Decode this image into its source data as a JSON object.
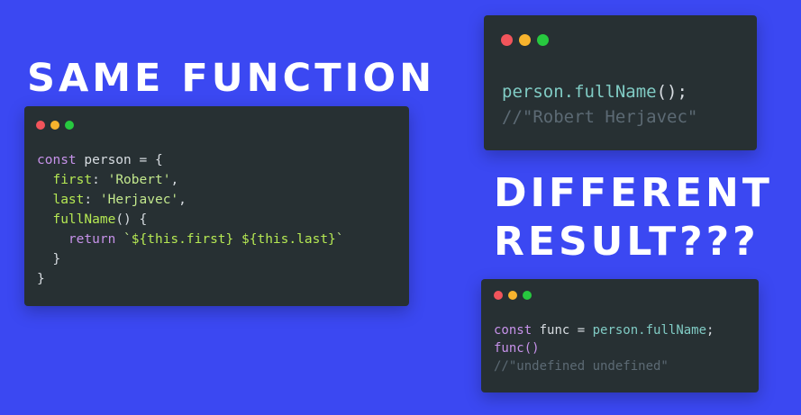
{
  "headline_top": "SAME FUNCTION",
  "headline_bottom_line1": "DIFFERENT",
  "headline_bottom_line2": "RESULT???",
  "colors": {
    "background": "#3b48f2",
    "window": "#273033",
    "dot_red": "#f2545b",
    "dot_yellow": "#f7b32d",
    "dot_green": "#27c93f"
  },
  "main_code": {
    "kw_const": "const",
    "var_person": " person = {",
    "key_first": "first",
    "val_first": "'Robert'",
    "key_last": "last",
    "val_last": "'Herjavec'",
    "method_name": "fullName",
    "method_sig": "() {",
    "kw_return": "return",
    "tmpl_open": "`",
    "interp_first": "${this.first}",
    "interp_last": "${this.last}",
    "tmpl_close": "`",
    "close_method": "  }",
    "close_obj": "}"
  },
  "call_code": {
    "obj": "person",
    "method": ".fullName",
    "call": "();",
    "comment": "//\"Robert Herjavec\""
  },
  "func_code": {
    "kw_const": "const",
    "decl": " func = ",
    "ref_obj": "person",
    "ref_method": ".fullName",
    "semicolon": ";",
    "call": "func()",
    "comment": "//\"undefined undefined\""
  }
}
